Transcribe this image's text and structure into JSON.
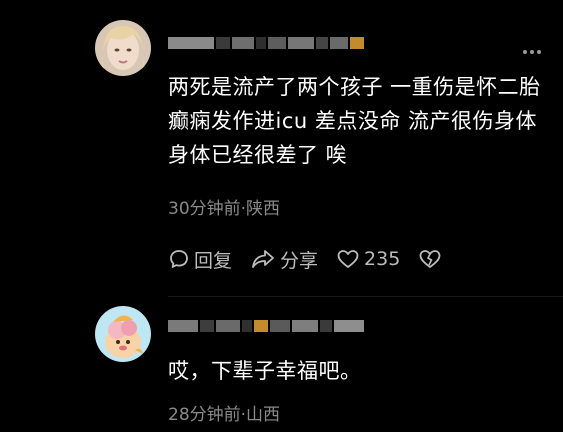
{
  "comments": [
    {
      "text": "两死是流产了两个孩子 一重伤是怀二胎癫痫发作进icu 差点没命 流产很伤身体 身体已经很差了 唉",
      "meta": "30分钟前·陕西",
      "actions": {
        "reply_label": "回复",
        "share_label": "分享",
        "like_count": "235"
      }
    },
    {
      "text": "哎，下辈子幸福吧。",
      "meta": "28分钟前·山西"
    }
  ],
  "colors": {
    "background": "#000000",
    "text": "#ffffff",
    "meta": "#8a8a8a",
    "action": "#bdbdbd"
  }
}
